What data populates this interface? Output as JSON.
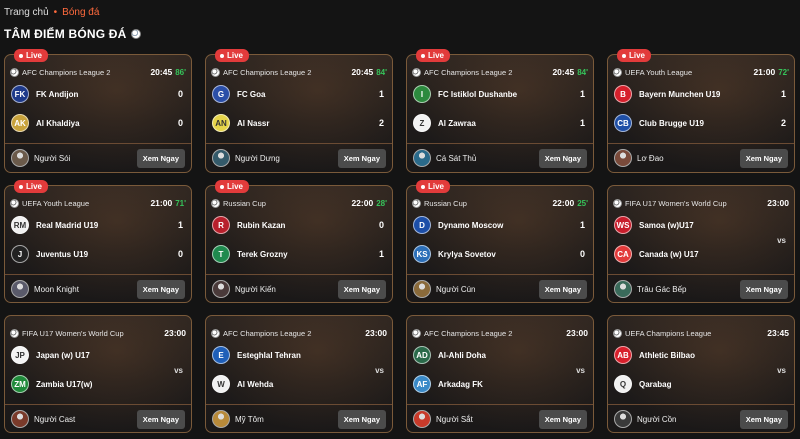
{
  "breadcrumb": {
    "home": "Trang chủ",
    "separator": "•",
    "current": "Bóng đá"
  },
  "section": {
    "title": "TÂM ĐIỂM BÓNG ĐÁ"
  },
  "colors": {
    "accent": "#ff6a3d",
    "live": "#e23b3b",
    "minute": "#36c35a",
    "card_border": "#7a5a3a"
  },
  "watch_label": "Xem Ngay",
  "live_label": "Live",
  "vs_label": "vs",
  "matches": [
    {
      "live": true,
      "league": "AFC Champions League 2",
      "time": "20:45",
      "minute": "86'",
      "home": {
        "name": "FK Andijon",
        "score": "0",
        "logo_color": "#1e3a8a",
        "logo_text": "FK"
      },
      "away": {
        "name": "Al Khaldiya",
        "score": "0",
        "logo_color": "#c8a23c",
        "logo_text": "AK"
      },
      "commentator": "Người Sói",
      "avatar_color": "#6b5a4a"
    },
    {
      "live": true,
      "league": "AFC Champions League 2",
      "time": "20:45",
      "minute": "84'",
      "home": {
        "name": "FC Goa",
        "score": "1",
        "logo_color": "#2b4fa8",
        "logo_text": "G"
      },
      "away": {
        "name": "Al Nassr",
        "score": "2",
        "logo_color": "#e6d44a",
        "logo_text": "AN"
      },
      "commentator": "Người Dưng",
      "avatar_color": "#345a6a"
    },
    {
      "live": true,
      "league": "AFC Champions League 2",
      "time": "20:45",
      "minute": "84'",
      "home": {
        "name": "FC Istiklol Dushanbe",
        "score": "1",
        "logo_color": "#2c8a3e",
        "logo_text": "I"
      },
      "away": {
        "name": "Al Zawraa",
        "score": "1",
        "logo_color": "#f2f2f2",
        "logo_text": "Z"
      },
      "commentator": "Cá Sát Thủ",
      "avatar_color": "#2a6a8a"
    },
    {
      "live": true,
      "league": "UEFA Youth League",
      "time": "21:00",
      "minute": "72'",
      "home": {
        "name": "Bayern Munchen U19",
        "score": "1",
        "logo_color": "#d6202c",
        "logo_text": "B"
      },
      "away": {
        "name": "Club Brugge U19",
        "score": "2",
        "logo_color": "#1f4fa6",
        "logo_text": "CB"
      },
      "commentator": "Lơ Đao",
      "avatar_color": "#7a4a3a"
    },
    {
      "live": true,
      "league": "UEFA Youth League",
      "time": "21:00",
      "minute": "71'",
      "home": {
        "name": "Real Madrid U19",
        "score": "1",
        "logo_color": "#f1f1f1",
        "logo_text": "RM"
      },
      "away": {
        "name": "Juventus U19",
        "score": "0",
        "logo_color": "#222222",
        "logo_text": "J"
      },
      "commentator": "Moon Knight",
      "avatar_color": "#5a5a6a"
    },
    {
      "live": true,
      "league": "Russian Cup",
      "time": "22:00",
      "minute": "28'",
      "home": {
        "name": "Rubin Kazan",
        "score": "0",
        "logo_color": "#b8202c",
        "logo_text": "R"
      },
      "away": {
        "name": "Terek Grozny",
        "score": "1",
        "logo_color": "#1f8a4e",
        "logo_text": "T"
      },
      "commentator": "Người Kiến",
      "avatar_color": "#4a3a3a"
    },
    {
      "live": true,
      "league": "Russian Cup",
      "time": "22:00",
      "minute": "25'",
      "home": {
        "name": "Dynamo Moscow",
        "score": "1",
        "logo_color": "#1d4fa8",
        "logo_text": "D"
      },
      "away": {
        "name": "Krylya Sovetov",
        "score": "0",
        "logo_color": "#2c6fb8",
        "logo_text": "KS"
      },
      "commentator": "Người Cún",
      "avatar_color": "#8a6a3a"
    },
    {
      "live": false,
      "league": "FIFA U17 Women's World Cup",
      "time": "23:00",
      "minute": "",
      "home": {
        "name": "Samoa (w)U17",
        "score": "",
        "logo_color": "#c81e2c",
        "logo_text": "WS"
      },
      "away": {
        "name": "Canada (w) U17",
        "score": "",
        "logo_color": "#e23a3a",
        "logo_text": "CA"
      },
      "commentator": "Trâu Gác Bếp",
      "avatar_color": "#3a6a5a"
    },
    {
      "live": false,
      "league": "FIFA U17 Women's World Cup",
      "time": "23:00",
      "minute": "",
      "home": {
        "name": "Japan (w) U17",
        "score": "",
        "logo_color": "#f4f4f4",
        "logo_text": "JP"
      },
      "away": {
        "name": "Zambia U17(w)",
        "score": "",
        "logo_color": "#1f8a3a",
        "logo_text": "ZM"
      },
      "commentator": "Người Cast",
      "avatar_color": "#7a3a2a"
    },
    {
      "live": false,
      "league": "AFC Champions League 2",
      "time": "23:00",
      "minute": "",
      "home": {
        "name": "Esteghlal Tehran",
        "score": "",
        "logo_color": "#1f5fb8",
        "logo_text": "E"
      },
      "away": {
        "name": "Al Wehda",
        "score": "",
        "logo_color": "#f1f1f1",
        "logo_text": "W"
      },
      "commentator": "Mỹ Tôm",
      "avatar_color": "#b88a3a"
    },
    {
      "live": false,
      "league": "AFC Champions League 2",
      "time": "23:00",
      "minute": "",
      "home": {
        "name": "Al-Ahli Doha",
        "score": "",
        "logo_color": "#2a6a4a",
        "logo_text": "AD"
      },
      "away": {
        "name": "Arkadag FK",
        "score": "",
        "logo_color": "#3a8ac8",
        "logo_text": "AF"
      },
      "commentator": "Người Sắt",
      "avatar_color": "#c83a2a"
    },
    {
      "live": false,
      "league": "UEFA Champions League",
      "time": "23:45",
      "minute": "",
      "home": {
        "name": "Athletic Bilbao",
        "score": "",
        "logo_color": "#d8202c",
        "logo_text": "AB"
      },
      "away": {
        "name": "Qarabag",
        "score": "",
        "logo_color": "#f1f1f1",
        "logo_text": "Q"
      },
      "commentator": "Người Cồn",
      "avatar_color": "#3a3a3a"
    }
  ]
}
